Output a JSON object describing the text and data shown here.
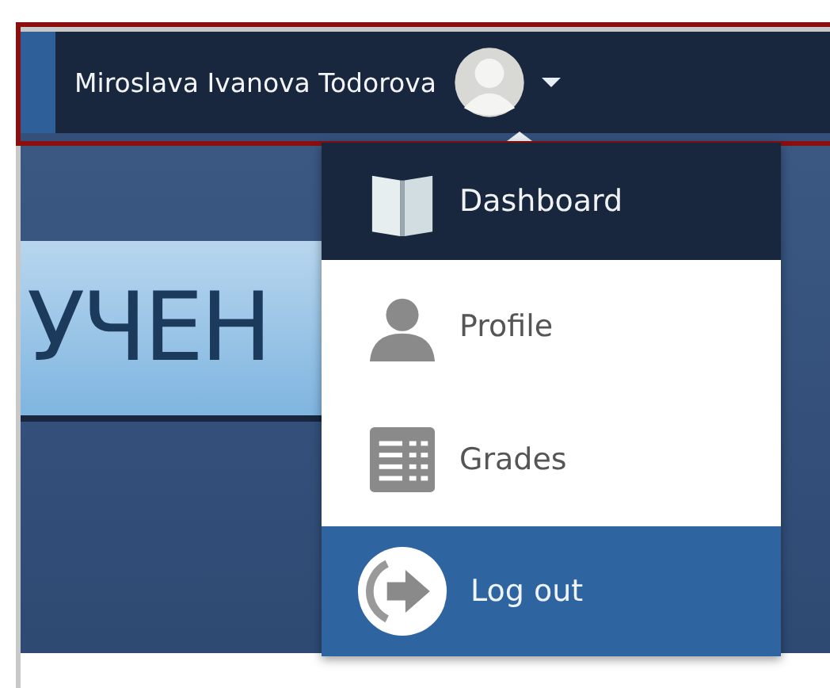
{
  "user_menu": {
    "name": "Miroslava Ivanova Todorova",
    "expanded": true
  },
  "banner": {
    "text": "УЧЕН"
  },
  "dropdown": [
    {
      "label": "Dashboard",
      "current": true,
      "selected": false
    },
    {
      "label": "Profile",
      "current": false,
      "selected": false
    },
    {
      "label": "Grades",
      "current": false,
      "selected": false
    },
    {
      "label": "Log out",
      "current": false,
      "selected": true
    }
  ]
}
